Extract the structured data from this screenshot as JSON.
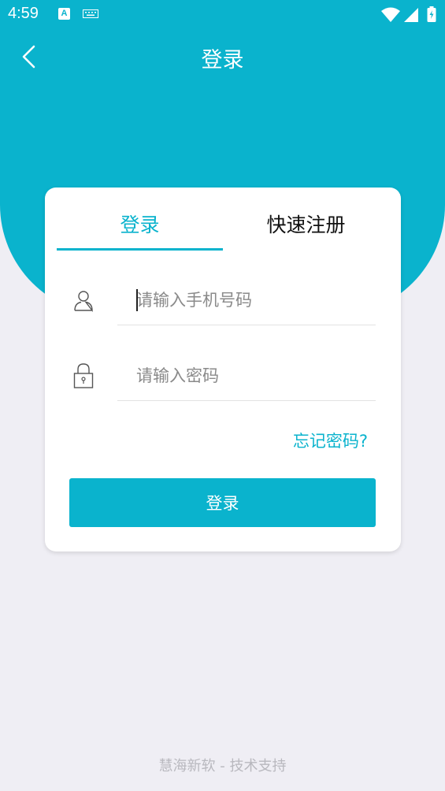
{
  "status_bar": {
    "time": "4:59",
    "notification_icon": "A",
    "icons": [
      "a-notification-icon",
      "keyboard-icon",
      "wifi-icon",
      "cell-signal-icon",
      "battery-charging-icon"
    ]
  },
  "header": {
    "back_icon": "chevron-left-icon",
    "title": "登录"
  },
  "tabs": [
    {
      "label": "登录",
      "active": true
    },
    {
      "label": "快速注册",
      "active": false
    }
  ],
  "form": {
    "phone": {
      "value": "",
      "placeholder": "请输入手机号码",
      "icon": "user-icon"
    },
    "password": {
      "value": "",
      "placeholder": "请输入密码",
      "icon": "lock-icon"
    },
    "forgot_label": "忘记密码?",
    "submit_label": "登录"
  },
  "footer": {
    "text": "慧海新软 - 技术支持"
  },
  "colors": {
    "accent": "#0ab3cd",
    "background": "#efeef4",
    "card": "#ffffff",
    "footer_text": "#b8b8be"
  }
}
